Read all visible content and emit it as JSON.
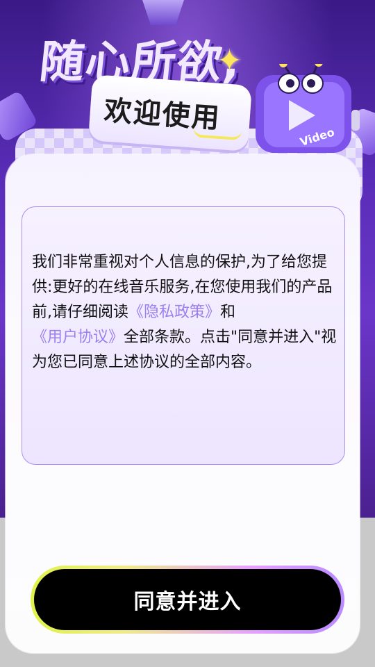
{
  "banner": {
    "title": "随心所欲,",
    "welcome": "欢迎使用",
    "mascot_label": "Video"
  },
  "privacy": {
    "text_1": "我们非常重视对个人信息的保护,为了给您提供:更好的在线音乐服务,在您使用我们的产品前,请仔细阅读",
    "privacy_policy_link": "《隐私政策》",
    "text_2": "和",
    "user_agreement_link": "《用户协议》",
    "text_3": "全部条款。点击\"同意并进入\"视为您已同意上述协议的全部内容。"
  },
  "actions": {
    "agree_label": "同意并进入"
  },
  "colors": {
    "link": "#9b7ef0",
    "button_bg": "#000000",
    "accent_yellow": "#e0f24a",
    "accent_purple": "#b98cff"
  }
}
